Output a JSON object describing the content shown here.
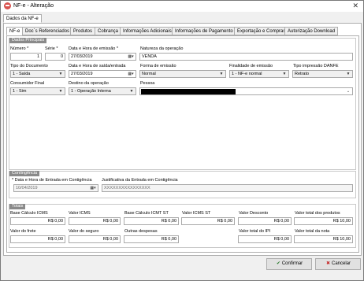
{
  "window": {
    "title": "NF-e - Alteração"
  },
  "outer_tab": "Dados da NF-e",
  "tabs": [
    "NF-e",
    "Doc´s Referenciados",
    "Produtos",
    "Cobrança",
    "Informações Adicionais",
    "Informações de Pagamento",
    "Exportação e Compras",
    "Autorização Download"
  ],
  "principais": {
    "legend": "Dados Principais",
    "numero_label": "Número *",
    "numero": "1",
    "serie_label": "Série *",
    "serie": "0",
    "emissao_label": "Data e Hora de emissão *",
    "emissao": "27/03/2019",
    "natureza_label": "Natureza da operação",
    "natureza": "VENDA",
    "tipo_doc_label": "Tipo do Documento",
    "tipo_doc": "1 - Saída",
    "saida_label": "Data e Hora de saída/entrada",
    "saida": "27/03/2019",
    "forma_label": "Forma de emissão",
    "forma": "Normal",
    "finalidade_label": "Finalidade de emissão",
    "finalidade": "1 - NF-e normal",
    "danfe_label": "Tipo impressão DANFE",
    "danfe": "Retrato",
    "consumidor_label": "Consumidor Final",
    "consumidor": "1 - Sim",
    "destino_label": "Destino da operação",
    "destino": "1 - Operação Interna",
    "pessoa_label": "Pessoa"
  },
  "contingencia": {
    "legend": "Contingência",
    "data_label": "* Data e Hora de Entrada em Contigência",
    "data": "10/04/2019",
    "just_label": "Justificativa da Entrada em Contigência",
    "just": "XXXXXXXXXXXXXXXX"
  },
  "totais": {
    "legend": "Totais",
    "bc_icms_label": "Base Cálculo ICMS",
    "bc_icms": "R$ 0,00",
    "icms_label": "Valor ICMS",
    "icms": "R$ 0,00",
    "bc_st_label": "Base Cálculo ICMT ST",
    "bc_st": "R$ 0,00",
    "icms_st_label": "Valor ICMS ST",
    "icms_st": "R$ 0,00",
    "desconto_label": "Valor Desconto",
    "desconto": "R$ 0,00",
    "produtos_label": "Valor total dos produtos",
    "produtos": "R$ 10,00",
    "frete_label": "Valor do frete",
    "frete": "R$ 0,00",
    "seguro_label": "Valor do seguro",
    "seguro": "R$ 0,00",
    "outras_label": "Outras despesas",
    "outras": "R$ 0,00",
    "ipi_label": "Valor total do IPI",
    "ipi": "R$ 0,00",
    "nota_label": "Valor total da nota",
    "nota": "R$ 10,00"
  },
  "buttons": {
    "confirmar": "Confirmar",
    "cancelar": "Cancelar"
  },
  "icons": {
    "app": "nfe-app-icon",
    "close": "close-icon",
    "confirm": "check-icon",
    "cancel": "cancel-x-icon"
  }
}
